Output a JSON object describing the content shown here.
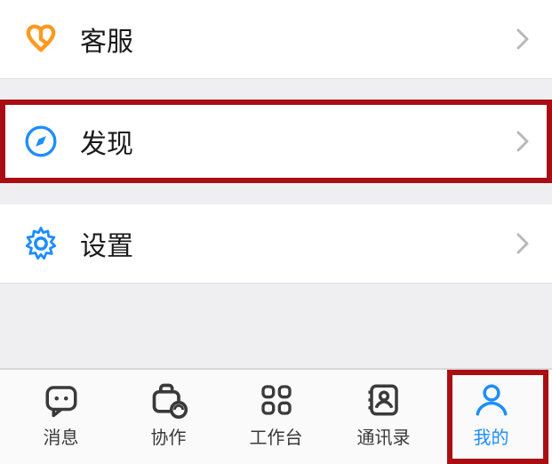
{
  "menu": {
    "customer_service": {
      "label": "客服"
    },
    "discover": {
      "label": "发现"
    },
    "settings": {
      "label": "设置"
    }
  },
  "tabs": {
    "messages": {
      "label": "消息"
    },
    "collab": {
      "label": "协作"
    },
    "workbench": {
      "label": "工作台"
    },
    "contacts": {
      "label": "通讯录"
    },
    "me": {
      "label": "我的"
    }
  },
  "colors": {
    "accent": "#1d8dff",
    "highlight": "#aa0e12",
    "service_icon": "#ff9a1e",
    "icon_gray": "#3a3a3a"
  }
}
